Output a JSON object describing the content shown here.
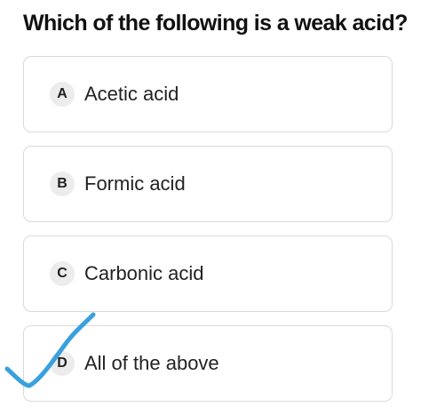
{
  "question": "Which of the following is a weak acid?",
  "options": [
    {
      "letter": "A",
      "text": "Acetic acid"
    },
    {
      "letter": "B",
      "text": "Formic acid"
    },
    {
      "letter": "C",
      "text": "Carbonic acid"
    },
    {
      "letter": "D",
      "text": "All of the above"
    }
  ],
  "annotation": {
    "mark": "check-icon",
    "color": "#3aa0dd"
  }
}
